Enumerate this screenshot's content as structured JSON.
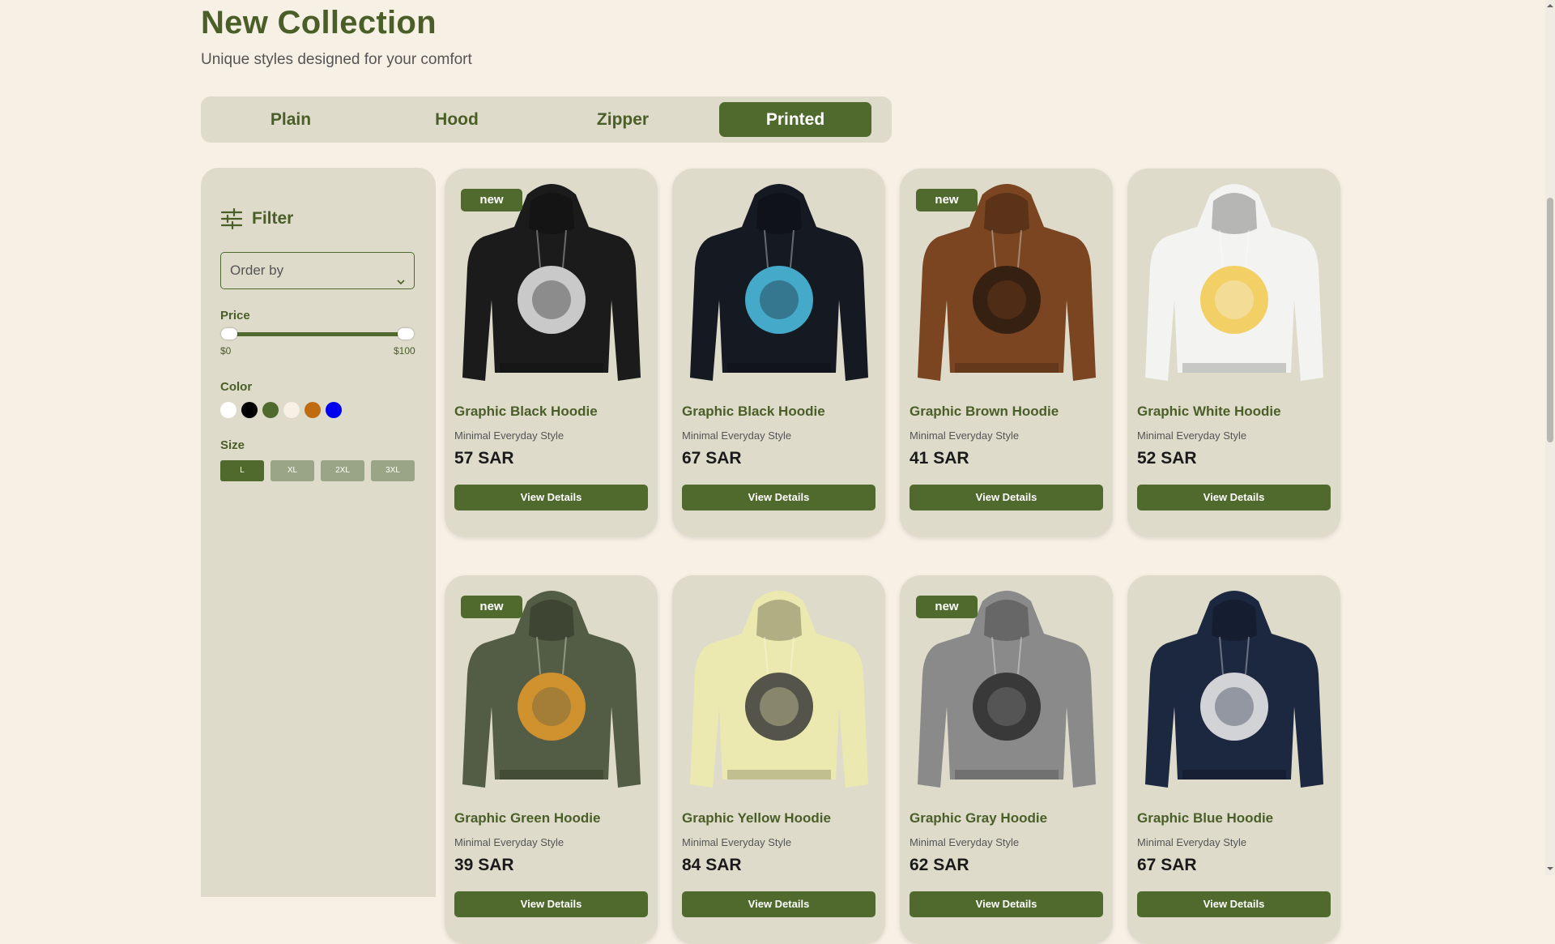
{
  "header": {
    "title": "New Collection",
    "subtitle": "Unique styles designed for your comfort"
  },
  "tabs": [
    {
      "label": "Plain",
      "active": false
    },
    {
      "label": "Hood",
      "active": false
    },
    {
      "label": "Zipper",
      "active": false
    },
    {
      "label": "Printed",
      "active": true
    }
  ],
  "filter": {
    "title": "Filter",
    "order_placeholder": "Order by",
    "price_label": "Price",
    "price_min": "$0",
    "price_max": "$100",
    "color_label": "Color",
    "colors": [
      "#ffffff",
      "#000000",
      "#4f6a2c",
      "#f7f0e5",
      "#c06a12",
      "#0000ee"
    ],
    "size_label": "Size",
    "sizes": [
      {
        "label": "L",
        "active": true
      },
      {
        "label": "XL",
        "active": false
      },
      {
        "label": "2XL",
        "active": false
      },
      {
        "label": "3XL",
        "active": false
      }
    ]
  },
  "products": [
    {
      "name": "Graphic Black Hoodie",
      "subtitle": "Minimal Everyday Style",
      "price": "57 SAR",
      "badge": "new",
      "button": "View Details",
      "hoodie_color": "#1b1b1b",
      "print_color": "#e8e8e8",
      "icon": "black-hoodie-image"
    },
    {
      "name": "Graphic Black Hoodie",
      "subtitle": "Minimal Everyday Style",
      "price": "67 SAR",
      "badge": "",
      "button": "View Details",
      "hoodie_color": "#151a22",
      "print_color": "#4ec3e8",
      "icon": "black-hoodie-image"
    },
    {
      "name": "Graphic Brown Hoodie",
      "subtitle": "Minimal Everyday Style",
      "price": "41 SAR",
      "badge": "new",
      "button": "View Details",
      "hoodie_color": "#7a4520",
      "print_color": "#2a1a10",
      "icon": "brown-hoodie-image"
    },
    {
      "name": "Graphic White Hoodie",
      "subtitle": "Minimal Everyday Style",
      "price": "52 SAR",
      "badge": "",
      "button": "View Details",
      "hoodie_color": "#f3f3f1",
      "print_color": "#f2c94c",
      "icon": "white-hoodie-image"
    },
    {
      "name": "Graphic Green Hoodie",
      "subtitle": "Minimal Everyday Style",
      "price": "39 SAR",
      "badge": "new",
      "button": "View Details",
      "hoodie_color": "#535c44",
      "print_color": "#e69a2b",
      "icon": "green-hoodie-image"
    },
    {
      "name": "Graphic Yellow Hoodie",
      "subtitle": "Minimal Everyday Style",
      "price": "84 SAR",
      "badge": "",
      "button": "View Details",
      "hoodie_color": "#ece9b0",
      "print_color": "#3a3a3a",
      "icon": "yellow-hoodie-image"
    },
    {
      "name": "Graphic Gray Hoodie",
      "subtitle": "Minimal Everyday Style",
      "price": "62 SAR",
      "badge": "new",
      "button": "View Details",
      "hoodie_color": "#8a8a8a",
      "print_color": "#2a2a2a",
      "icon": "gray-hoodie-image"
    },
    {
      "name": "Graphic Blue Hoodie",
      "subtitle": "Minimal Everyday Style",
      "price": "67 SAR",
      "badge": "",
      "button": "View Details",
      "hoodie_color": "#1c2740",
      "print_color": "#f2f2f2",
      "icon": "blue-hoodie-image"
    }
  ]
}
